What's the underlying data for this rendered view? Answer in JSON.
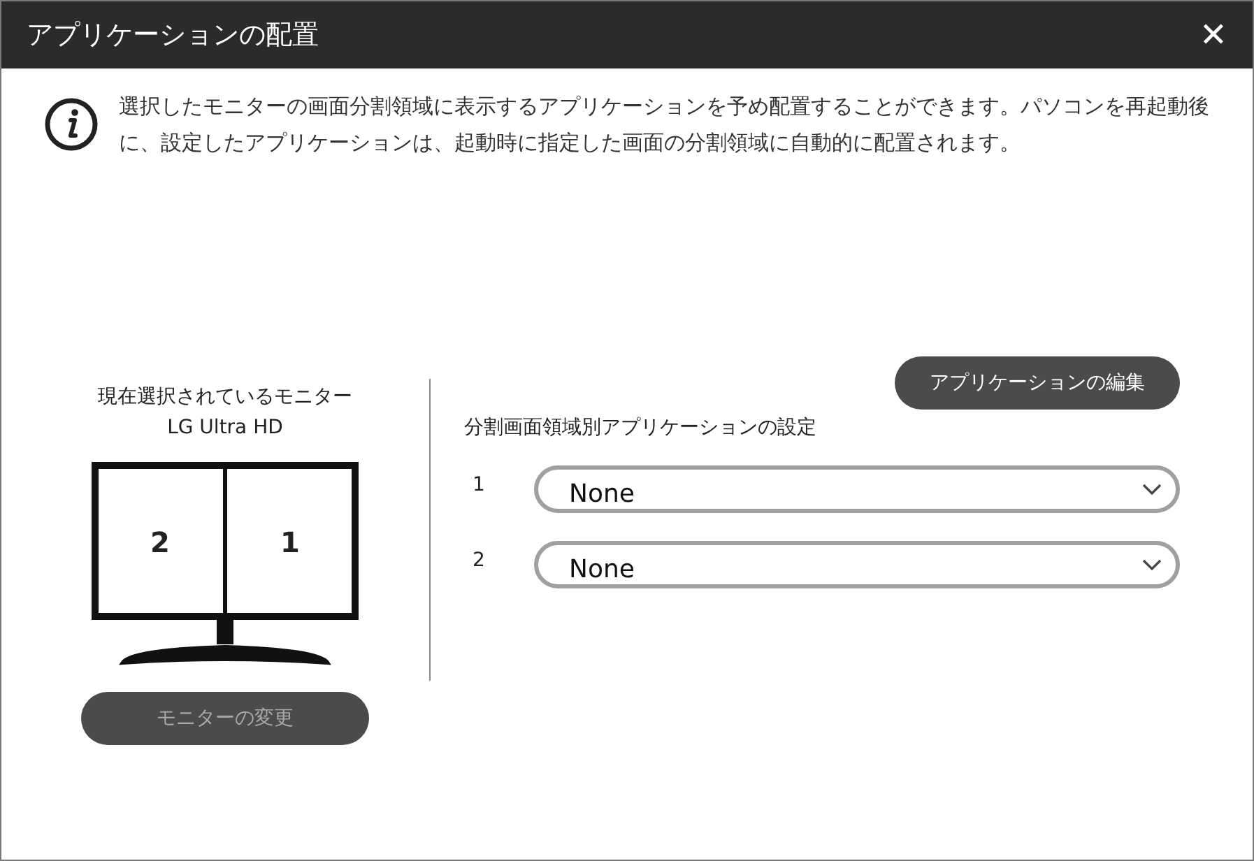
{
  "window": {
    "title": "アプリケーションの配置",
    "close": "✕"
  },
  "info": {
    "text": "選択したモニターの画面分割領域に表示するアプリケーションを予め配置することができます。パソコンを再起動後に、設定したアプリケーションは、起動時に指定した画面の分割領域に自動的に配置されます。"
  },
  "monitor": {
    "caption": "現在選択されているモニター",
    "name": "LG Ultra HD",
    "regions": [
      "2",
      "1"
    ],
    "change_button": {
      "label": "モニターの変更",
      "disabled": true
    }
  },
  "settings": {
    "edit_button": {
      "label": "アプリケーションの編集",
      "disabled": false
    },
    "heading": "分割画面領域別アプリケーションの設定",
    "rows": [
      {
        "number": "1",
        "value": "None"
      },
      {
        "number": "2",
        "value": "None"
      }
    ]
  }
}
